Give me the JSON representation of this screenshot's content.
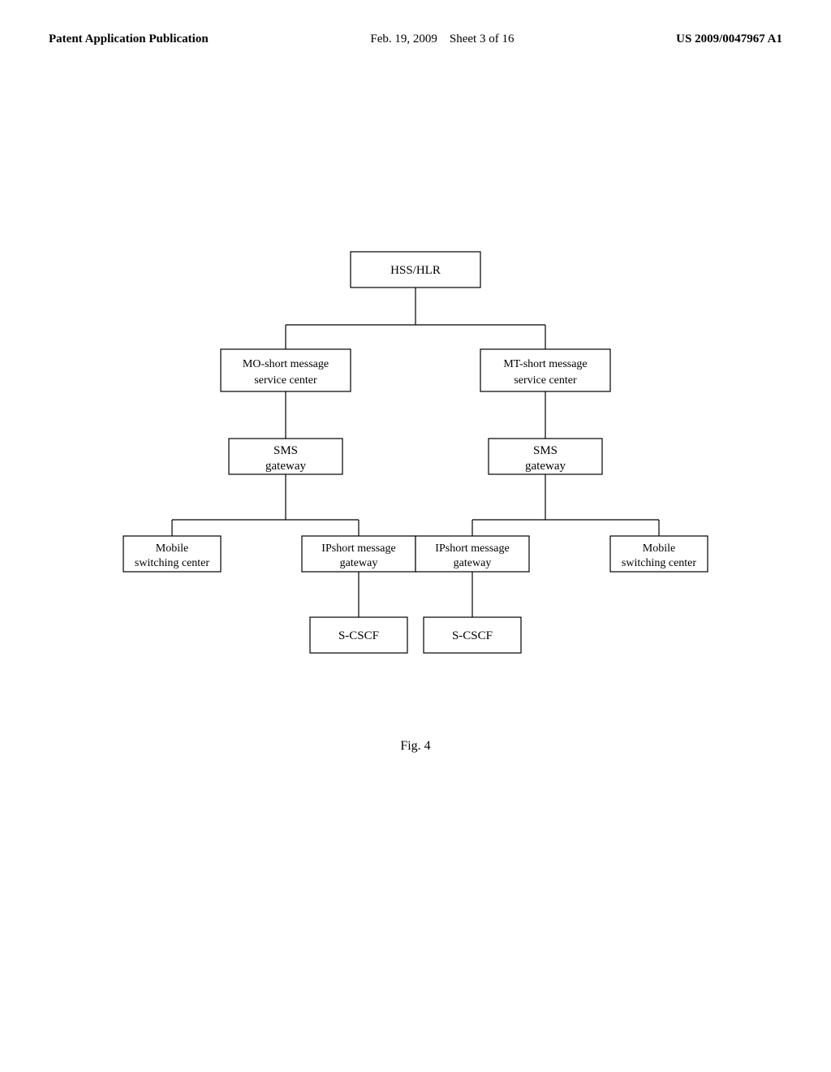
{
  "header": {
    "left": "Patent Application Publication",
    "center_date": "Feb. 19, 2009",
    "center_sheet": "Sheet 3 of 16",
    "right": "US 2009/0047967 A1"
  },
  "diagram": {
    "nodes": {
      "hss_hlr": "HSS/HLR",
      "mo_smsc": "MO-short message\nservice center",
      "mt_smsc": "MT-short message\nservice center",
      "sms_gw_left": "SMS\ngateway",
      "sms_gw_right": "SMS\ngateway",
      "mobile_sw_left": "Mobile\nswitching center",
      "ip_msg_gw_left": "IPshort message\ngateway",
      "ip_msg_gw_right": "IPshort message\ngateway",
      "mobile_sw_right": "Mobile\nswitching center",
      "s_cscf_left": "S-CSCF",
      "s_cscf_right": "S-CSCF"
    }
  },
  "figure_caption": "Fig. 4"
}
